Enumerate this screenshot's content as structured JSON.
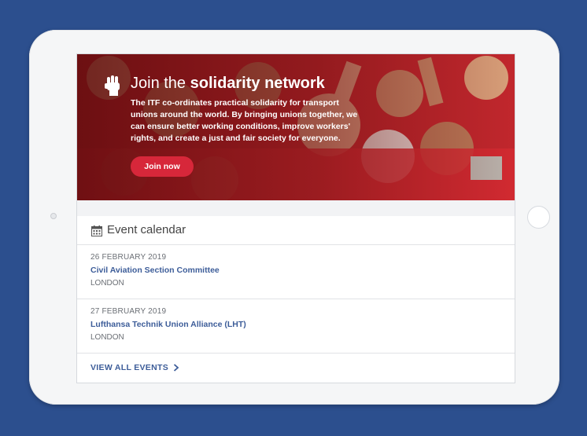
{
  "hero": {
    "title_prefix": "Join the ",
    "title_bold": "solidarity network",
    "body": "The ITF co-ordinates practical solidarity for transport unions around the world. By bringing unions together, we can ensure better working conditions, improve workers' rights, and create a just and fair society for everyone.",
    "button_label": "Join now",
    "icon": "raised-fist-icon"
  },
  "calendar": {
    "title": "Event calendar",
    "icon": "calendar-icon",
    "events": [
      {
        "date": "26 FEBRUARY 2019",
        "name": "Civil Aviation Section Committee",
        "location": "LONDON"
      },
      {
        "date": "27 FEBRUARY 2019",
        "name": "Lufthansa Technik Union Alliance (LHT)",
        "location": "LONDON"
      }
    ],
    "view_all_label": "VIEW ALL EVENTS",
    "view_all_icon": "chevron-right-icon"
  },
  "colors": {
    "background": "#2c4f8e",
    "accent_red": "#d7273a",
    "link_blue": "#3d5d99"
  }
}
